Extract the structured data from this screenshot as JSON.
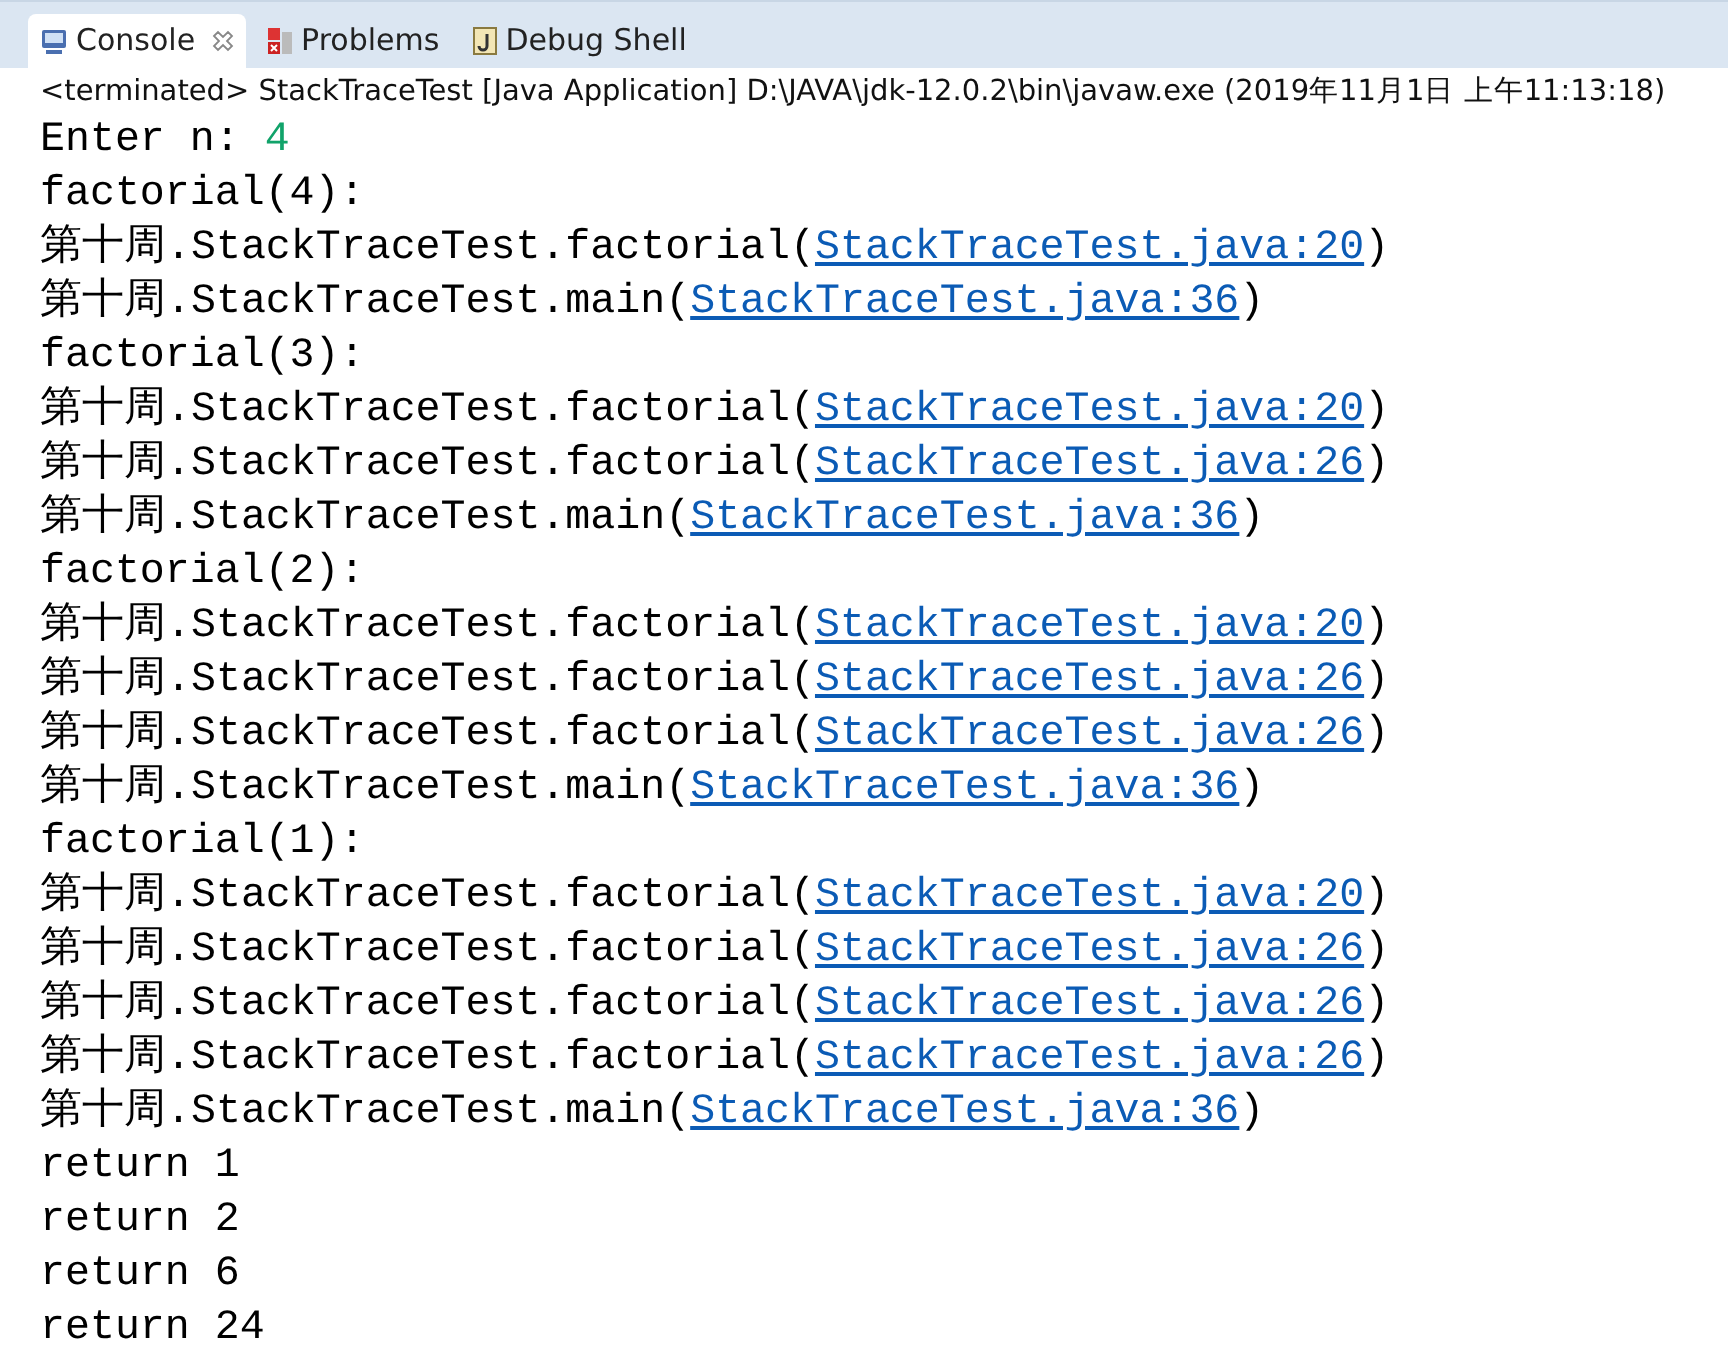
{
  "tabs": [
    {
      "label": "Console",
      "kind": "console",
      "selected": true,
      "closable": true
    },
    {
      "label": "Problems",
      "kind": "problems",
      "selected": false,
      "closable": false
    },
    {
      "label": "Debug Shell",
      "kind": "shell",
      "selected": false,
      "closable": false
    }
  ],
  "status": "<terminated> StackTraceTest [Java Application] D:\\JAVA\\jdk-12.0.2\\bin\\javaw.exe (2019年11月1日 上午11:13:18)",
  "lines": [
    {
      "kind": "input",
      "prompt": "Enter n:",
      "value": "4"
    },
    {
      "kind": "text",
      "text": "factorial(4):"
    },
    {
      "kind": "trace",
      "prefix": "第十周.StackTraceTest.factorial(",
      "link": "StackTraceTest.java:20",
      "suffix": ")"
    },
    {
      "kind": "trace",
      "prefix": "第十周.StackTraceTest.main(",
      "link": "StackTraceTest.java:36",
      "suffix": ")"
    },
    {
      "kind": "text",
      "text": "factorial(3):"
    },
    {
      "kind": "trace",
      "prefix": "第十周.StackTraceTest.factorial(",
      "link": "StackTraceTest.java:20",
      "suffix": ")"
    },
    {
      "kind": "trace",
      "prefix": "第十周.StackTraceTest.factorial(",
      "link": "StackTraceTest.java:26",
      "suffix": ")"
    },
    {
      "kind": "trace",
      "prefix": "第十周.StackTraceTest.main(",
      "link": "StackTraceTest.java:36",
      "suffix": ")"
    },
    {
      "kind": "text",
      "text": "factorial(2):"
    },
    {
      "kind": "trace",
      "prefix": "第十周.StackTraceTest.factorial(",
      "link": "StackTraceTest.java:20",
      "suffix": ")"
    },
    {
      "kind": "trace",
      "prefix": "第十周.StackTraceTest.factorial(",
      "link": "StackTraceTest.java:26",
      "suffix": ")"
    },
    {
      "kind": "trace",
      "prefix": "第十周.StackTraceTest.factorial(",
      "link": "StackTraceTest.java:26",
      "suffix": ")"
    },
    {
      "kind": "trace",
      "prefix": "第十周.StackTraceTest.main(",
      "link": "StackTraceTest.java:36",
      "suffix": ")"
    },
    {
      "kind": "text",
      "text": "factorial(1):"
    },
    {
      "kind": "trace",
      "prefix": "第十周.StackTraceTest.factorial(",
      "link": "StackTraceTest.java:20",
      "suffix": ")"
    },
    {
      "kind": "trace",
      "prefix": "第十周.StackTraceTest.factorial(",
      "link": "StackTraceTest.java:26",
      "suffix": ")"
    },
    {
      "kind": "trace",
      "prefix": "第十周.StackTraceTest.factorial(",
      "link": "StackTraceTest.java:26",
      "suffix": ")"
    },
    {
      "kind": "trace",
      "prefix": "第十周.StackTraceTest.factorial(",
      "link": "StackTraceTest.java:26",
      "suffix": ")"
    },
    {
      "kind": "trace",
      "prefix": "第十周.StackTraceTest.main(",
      "link": "StackTraceTest.java:36",
      "suffix": ")"
    },
    {
      "kind": "text",
      "text": "return 1"
    },
    {
      "kind": "text",
      "text": "return 2"
    },
    {
      "kind": "text",
      "text": "return 6"
    },
    {
      "kind": "text",
      "text": "return 24"
    }
  ]
}
